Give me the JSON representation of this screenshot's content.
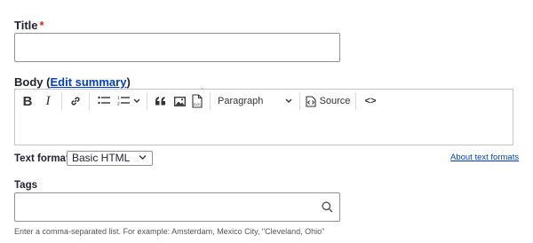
{
  "title_field": {
    "label": "Title",
    "required_mark": "*",
    "value": ""
  },
  "body_field": {
    "label": "Body",
    "open_paren": "(",
    "edit_summary_link": "Edit summary",
    "close_paren": ")",
    "toolbar": {
      "bold": "B",
      "italic": "I",
      "heading_select": "Paragraph",
      "source_label": "Source",
      "code_label": "<>"
    },
    "content": ""
  },
  "text_format": {
    "label": "Text format",
    "selected": "Basic HTML",
    "about_link": "About text formats"
  },
  "tags_field": {
    "label": "Tags",
    "value": "",
    "description": "Enter a comma-separated list. For example: Amsterdam, Mexico City, \"Cleveland, Ohio\""
  },
  "icons": {
    "search": "search-icon",
    "link": "link-icon",
    "bulleted_list": "bulleted-list-icon",
    "numbered_list": "numbered-list-icon",
    "blockquote": "blockquote-icon",
    "image": "image-icon",
    "svg": "svg-icon",
    "source": "source-icon",
    "cursor": "mouse-cursor-icon"
  }
}
